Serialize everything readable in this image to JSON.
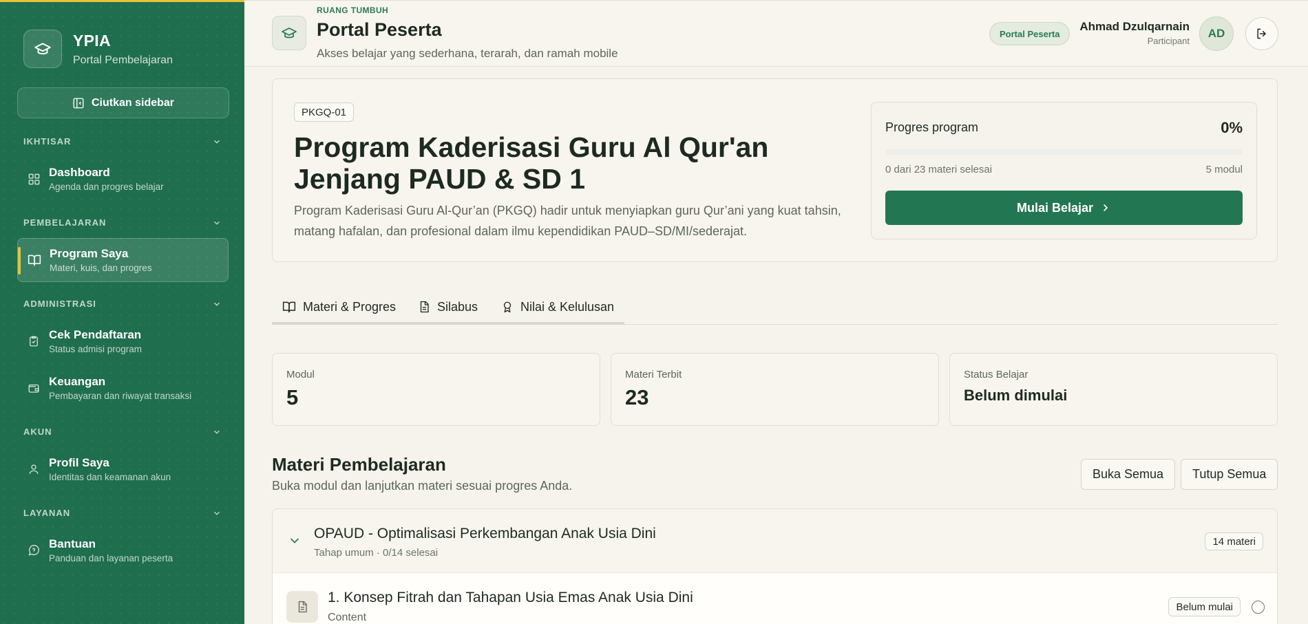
{
  "sidebar": {
    "brand": {
      "title": "YPIA",
      "subtitle": "Portal Pembelajaran",
      "icon": "graduation-cap-icon"
    },
    "collapse_label": "Ciutkan sidebar",
    "sections": [
      {
        "label": "IKHTISAR"
      },
      {
        "label": "PEMBELAJARAN"
      },
      {
        "label": "ADMINISTRASI"
      },
      {
        "label": "AKUN"
      },
      {
        "label": "LAYANAN"
      }
    ],
    "items": [
      {
        "label": "Dashboard",
        "sub": "Agenda dan progres belajar",
        "icon": "dashboard-icon"
      },
      {
        "label": "Program Saya",
        "sub": "Materi, kuis, dan progres",
        "icon": "book-icon",
        "active": true
      },
      {
        "label": "Cek Pendaftaran",
        "sub": "Status admisi program",
        "icon": "clipboard-check-icon"
      },
      {
        "label": "Keuangan",
        "sub": "Pembayaran dan riwayat transaksi",
        "icon": "wallet-icon"
      },
      {
        "label": "Profil Saya",
        "sub": "Identitas dan keamanan akun",
        "icon": "user-icon"
      },
      {
        "label": "Bantuan",
        "sub": "Panduan dan layanan peserta",
        "icon": "help-chat-icon"
      }
    ]
  },
  "header": {
    "eyebrow": "RUANG TUMBUH",
    "title": "Portal Peserta",
    "subtitle": "Akses belajar yang sederhana, terarah, dan ramah mobile",
    "role_badge": "Portal Peserta",
    "user_name": "Ahmad Dzulqarnain",
    "user_role": "Participant",
    "avatar_initials": "AD"
  },
  "program": {
    "code": "PKGQ-01",
    "title": "Program Kaderisasi Guru Al Qur'an Jenjang PAUD & SD 1",
    "description": "Program Kaderisasi Guru Al-Qur’an (PKGQ) hadir untuk menyiapkan guru Qur’ani yang kuat tahsin, matang hafalan, dan profesional dalam ilmu kependidikan PAUD–SD/MI/sederajat.",
    "progress_label": "Progres program",
    "progress_pct_text": "0%",
    "progress_value": 0,
    "progress_count": "0 dari 23 materi selesai",
    "progress_modules": "5 modul",
    "start_label": "Mulai Belajar"
  },
  "tabs": [
    {
      "label": "Materi & Progres",
      "icon": "book-open-icon",
      "active": true
    },
    {
      "label": "Silabus",
      "icon": "document-icon"
    },
    {
      "label": "Nilai & Kelulusan",
      "icon": "award-icon"
    }
  ],
  "stats": [
    {
      "label": "Modul",
      "value": "5"
    },
    {
      "label": "Materi Terbit",
      "value": "23"
    },
    {
      "label": "Status Belajar",
      "value": "Belum dimulai"
    }
  ],
  "materi": {
    "title": "Materi Pembelajaran",
    "subtitle": "Buka modul dan lanjutkan materi sesuai progres Anda.",
    "expand_all": "Buka Semua",
    "collapse_all": "Tutup Semua",
    "module": {
      "title": "OPAUD - Optimalisasi Perkembangan Anak Usia Dini",
      "sub": "Tahap umum · 0/14 selesai",
      "count": "14 materi",
      "lesson": {
        "title": "1. Konsep Fitrah dan Tahapan Usia Emas Anak Usia Dini",
        "type": "Content",
        "status": "Belum mulai"
      }
    }
  },
  "colors": {
    "sidebar_bg": "#1f6e4e",
    "accent": "#237652",
    "highlight": "#e9c338",
    "page_bg": "#f6f3ec"
  }
}
